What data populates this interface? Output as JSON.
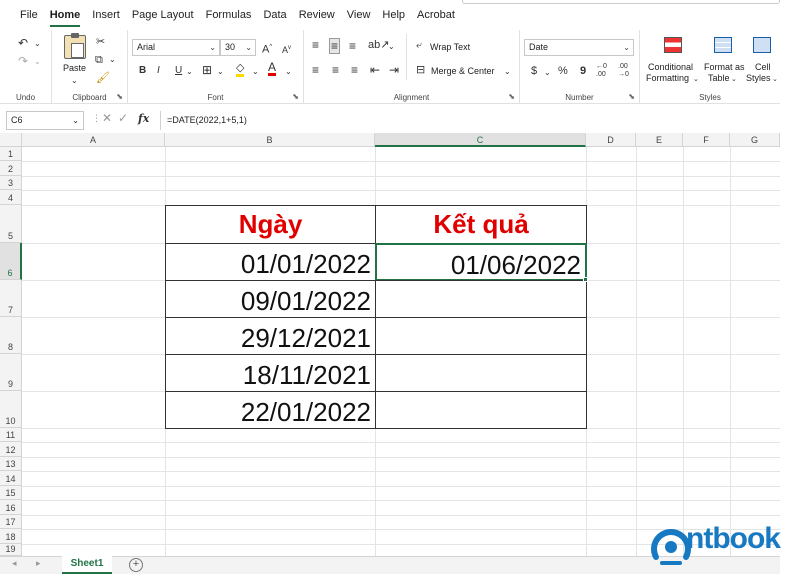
{
  "menu": {
    "items": [
      "File",
      "Home",
      "Insert",
      "Page Layout",
      "Formulas",
      "Data",
      "Review",
      "View",
      "Help",
      "Acrobat"
    ],
    "active_index": 1
  },
  "ribbon": {
    "undo": {
      "label": "Undo"
    },
    "clipboard": {
      "paste_label": "Paste",
      "label": "Clipboard"
    },
    "font": {
      "name": "Arial",
      "size": "30",
      "label": "Font",
      "bold": "B",
      "italic": "I",
      "underline": "U"
    },
    "alignment": {
      "wrap_text": "Wrap Text",
      "merge_center": "Merge & Center",
      "label": "Alignment"
    },
    "number": {
      "format": "Date",
      "currency": "$",
      "percent": "%",
      "comma": "9",
      "label": "Number"
    },
    "styles": {
      "conditional_1": "Conditional",
      "conditional_2": "Formatting",
      "format_table_1": "Format as",
      "format_table_2": "Table",
      "cell_styles_1": "Cell",
      "cell_styles_2": "Styles",
      "label": "Styles"
    }
  },
  "formula_bar": {
    "name_box": "C6",
    "fx": "fx",
    "formula": "=DATE(2022,1+5,1)"
  },
  "columns": [
    "A",
    "B",
    "C",
    "D",
    "E",
    "F",
    "G"
  ],
  "rows": [
    "1",
    "2",
    "3",
    "4",
    "5",
    "6",
    "7",
    "8",
    "9",
    "10",
    "11",
    "12",
    "13",
    "14",
    "15",
    "16",
    "17",
    "18",
    "19"
  ],
  "table": {
    "header_date": "Ngày",
    "header_result": "Kết quả",
    "dates": [
      "01/01/2022",
      "09/01/2022",
      "29/12/2021",
      "18/11/2021",
      "22/01/2022"
    ],
    "results": [
      "01/06/2022",
      "",
      "",
      "",
      ""
    ]
  },
  "sheets": {
    "tabs": [
      "Sheet1"
    ],
    "add": "+"
  },
  "logo": {
    "text": "ntbook"
  },
  "colors": {
    "accent": "#217346",
    "header_red": "#e00000",
    "logo_blue": "#1679c2"
  }
}
